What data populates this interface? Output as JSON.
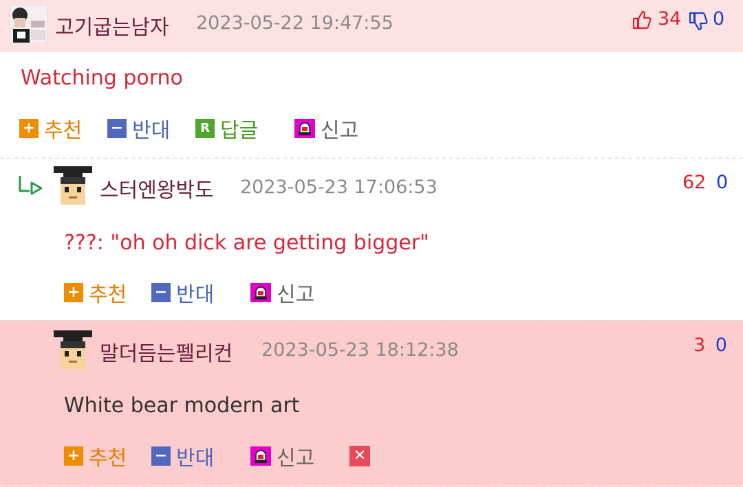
{
  "comments": [
    {
      "nickname": "고기굽는남자",
      "date": "2023-05-22 19:47:55",
      "up": "34",
      "down": "0",
      "text": "Watching porno",
      "actions": {
        "up": "추천",
        "down": "반대",
        "reply": "답글",
        "report": "신고"
      }
    },
    {
      "nickname": "스터엔왕박도",
      "date": "2023-05-23 17:06:53",
      "up": "62",
      "down": "0",
      "text": "???: \"oh oh dick are getting bigger\"",
      "actions": {
        "up": "추천",
        "down": "반대",
        "report": "신고"
      }
    },
    {
      "nickname": "말더듬는펠리컨",
      "date": "2023-05-23 18:12:38",
      "up": "3",
      "down": "0",
      "text": "White bear modern art",
      "actions": {
        "up": "추천",
        "down": "반대",
        "report": "신고"
      }
    }
  ],
  "icons": {
    "up_box": "plus-icon",
    "down_box": "minus-icon",
    "reply_box": "reply-r-icon",
    "report_box": "siren-icon",
    "delete_box": "close-icon",
    "thumb_up": "thumbs-up-icon",
    "thumb_down": "thumbs-down-icon"
  },
  "colors": {
    "header_bg": "#fde2e4",
    "highlight_bg": "#fdcccd",
    "up_color": "#e0202b",
    "down_color": "#1a3fd0"
  }
}
